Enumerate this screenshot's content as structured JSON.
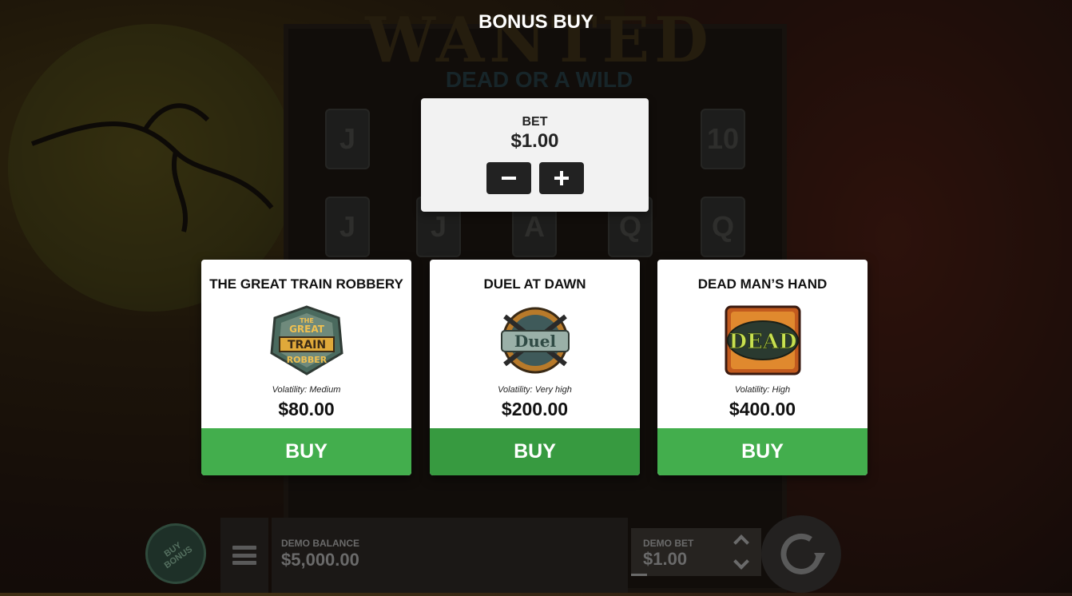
{
  "modal": {
    "title": "BONUS BUY"
  },
  "background_logo": {
    "main": "WANTED",
    "sub": "DEAD OR A WILD"
  },
  "bet": {
    "label": "BET",
    "value": "$1.00",
    "minus_label": "−",
    "plus_label": "+"
  },
  "cards": [
    {
      "title": "THE GREAT TRAIN ROBBERY",
      "icon": "great-train-robbery-badge-icon",
      "icon_lines": [
        "THE",
        "GREAT",
        "TRAIN",
        "ROBBER"
      ],
      "volatility": "Volatility: Medium",
      "price": "$80.00",
      "buy_label": "BUY"
    },
    {
      "title": "DUEL AT DAWN",
      "icon": "duel-badge-icon",
      "icon_text": "Duel",
      "volatility": "Volatility: Very high",
      "price": "$200.00",
      "buy_label": "BUY"
    },
    {
      "title": "DEAD MAN’S HAND",
      "icon": "dead-badge-icon",
      "icon_text": "DEAD",
      "volatility": "Volatility: High",
      "price": "$400.00",
      "buy_label": "BUY"
    }
  ],
  "bottom_bar": {
    "buy_bonus_label": "BUY BONUS",
    "balance_label": "DEMO BALANCE",
    "balance_value": "$5,000.00",
    "demo_bet_label": "DEMO BET",
    "demo_bet_value": "$1.00"
  },
  "reel_symbols": [
    "J",
    "J",
    "10",
    "J",
    "J",
    "A",
    "Q",
    "Q"
  ],
  "colors": {
    "buy_green": "#43ae4d",
    "buy_green_active": "#379a40",
    "panel_bg": "#f2f2f2",
    "bet_button": "#222222"
  }
}
